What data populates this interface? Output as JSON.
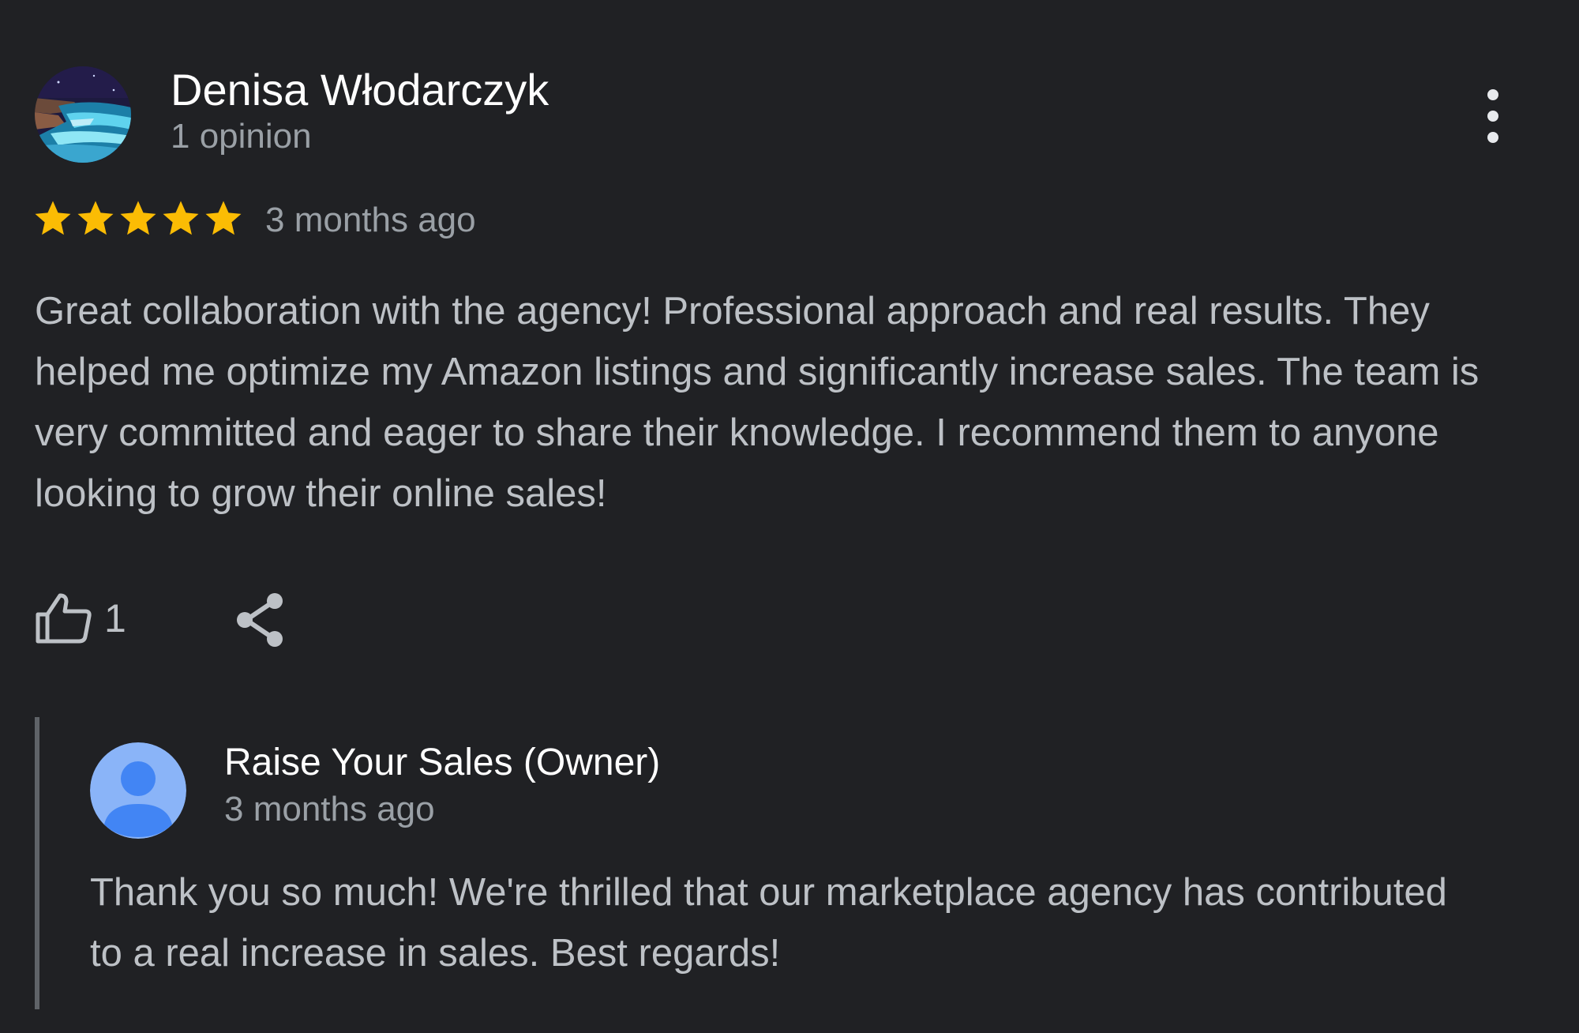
{
  "review": {
    "reviewer_name": "Denisa Włodarczyk",
    "reviewer_meta": "1 opinion",
    "rating": 5,
    "rating_max": 5,
    "time": "3 months ago",
    "text": "Great collaboration with the agency! Professional approach and real results. They helped me optimize my Amazon listings and significantly increase sales. The team is very committed and eager to share their knowledge. I recommend them to anyone looking to grow their online sales!",
    "like_count": "1"
  },
  "reply": {
    "owner_name": "Raise Your Sales (Owner)",
    "time": "3 months ago",
    "text": "Thank you so much! We're thrilled that our marketplace agency has contributed to a real increase in sales. Best regards!"
  },
  "icons": {
    "more": "more-vert-icon",
    "like": "thumbs-up-icon",
    "share": "share-icon",
    "star": "star-icon",
    "owner_avatar": "person-icon"
  },
  "colors": {
    "background": "#202124",
    "star": "#fbbc04",
    "primary_text": "#ffffff",
    "secondary_text": "#9aa0a6",
    "body_text": "#bdc1c6",
    "owner_avatar_bg": "#8ab4f8",
    "owner_avatar_fg": "#4285f4"
  }
}
